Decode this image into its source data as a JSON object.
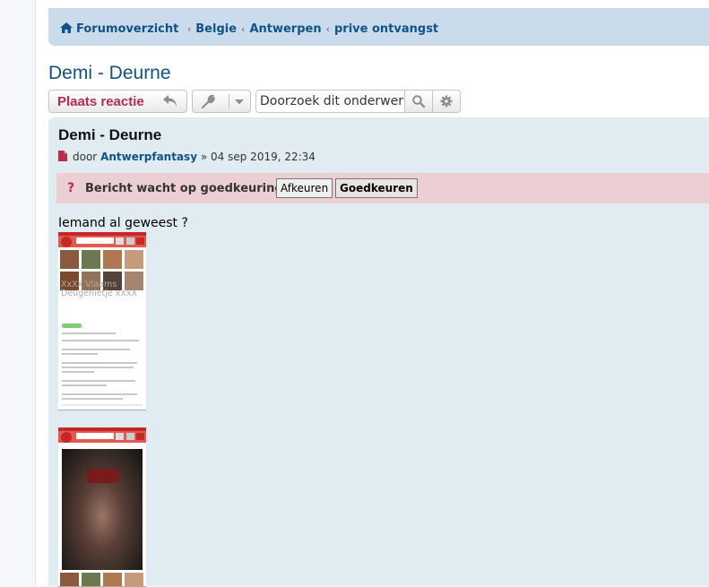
{
  "breadcrumbs": {
    "home_label": "Forumoverzicht",
    "items": [
      "Belgie",
      "Antwerpen",
      "prive ontvangst"
    ]
  },
  "topic": {
    "title": "Demi - Deurne"
  },
  "toolbar": {
    "reply_label": "Plaats reactie",
    "search_placeholder": "Doorzoek dit onderwerp…"
  },
  "post": {
    "title": "Demi - Deurne",
    "by_prefix": "door",
    "author": "Antwerpfantasy",
    "date_sep": "»",
    "date": "04 sep 2019, 22:34",
    "approval": {
      "icon": "?",
      "message": "Bericht wacht op goedkeuring:",
      "reject_label": "Afkeuren",
      "approve_label": "Goedkeuren"
    },
    "body": "Iemand al geweest ?",
    "thumb1": {
      "heading": "XxXx Vlaams Deugenietje xXxX"
    }
  },
  "colors": {
    "nav_bg": "#cadceb",
    "link": "#105289",
    "accent_red": "#bc2a4d",
    "post_bg": "#e1ebf2",
    "approval_bg": "#ebcfd3"
  },
  "icons": {
    "home": "home-icon",
    "reply": "reply-icon",
    "tools": "wrench-icon",
    "dropdown": "caret-down-icon",
    "search": "search-icon",
    "advanced_search": "gear-icon",
    "post_type": "document-icon"
  }
}
